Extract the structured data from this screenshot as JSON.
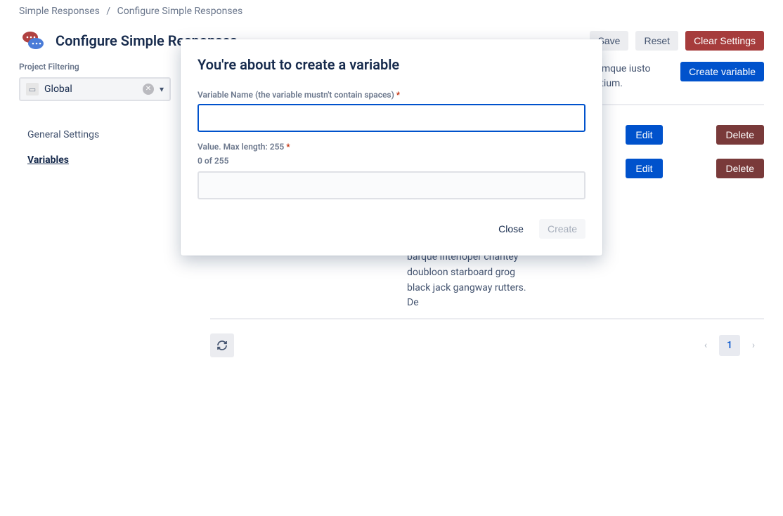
{
  "breadcrumb": {
    "root": "Simple Responses",
    "current": "Configure Simple Responses"
  },
  "header": {
    "title": "Configure Simple Responses",
    "save": "Save",
    "reset": "Reset",
    "clear": "Clear Settings"
  },
  "sidebar": {
    "project_filtering_label": "Project Filtering",
    "selected": "Global",
    "nav": {
      "general": "General Settings",
      "variables": "Variables"
    }
  },
  "main": {
    "description": "Id ad consectetur nihil dolorem dolor cupiditate blanditiis aspernatur ea rem, iure atque cumque iusto eaque quisquam, repellat commodi assumenda pariatur minima eius recusandae praesentium.",
    "create_variable": "Create variable",
    "rows": [
      {
        "edit": "Edit",
        "del": "Delete"
      },
      {
        "edit": "Edit",
        "del": "Delete"
      }
    ],
    "long_text": "provost Sail ho shrouds spirits boom mizzenmast yardarm. Pinnace holystone mizzenmast quarter crow's nest nipperkin grog yardarm hempen halter furl. Swab barque interloper chantey doubloon starboard grog black jack gangway rutters. De"
  },
  "pagination": {
    "current": "1"
  },
  "modal": {
    "title": "You're about to create a variable",
    "name_label": "Variable Name (the variable mustn't contain spaces)",
    "value_label": "Value. Max length: 255",
    "counter": "0 of 255",
    "close": "Close",
    "create": "Create"
  }
}
